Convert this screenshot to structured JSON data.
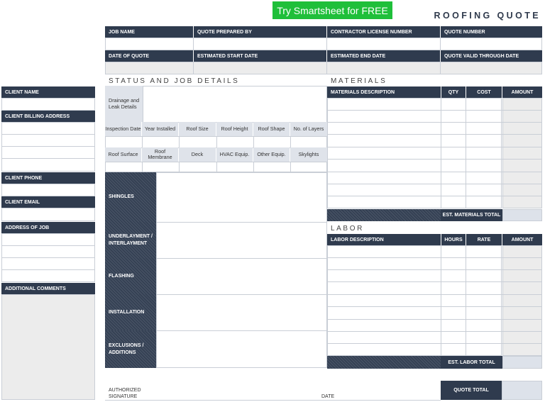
{
  "cta": "Try Smartsheet for FREE",
  "title": "ROOFING QUOTE",
  "header_fields": {
    "row1": [
      "JOB NAME",
      "QUOTE PREPARED BY",
      "CONTRACTOR LICENSE NUMBER",
      "QUOTE NUMBER"
    ],
    "row2": [
      "DATE OF QUOTE",
      "ESTIMATED START DATE",
      "ESTIMATED END DATE",
      "QUOTE VALID THROUGH DATE"
    ]
  },
  "client": {
    "name": "CLIENT NAME",
    "billing": "CLIENT BILLING ADDRESS",
    "phone": "CLIENT PHONE",
    "email": "CLIENT EMAIL",
    "address": "ADDRESS OF JOB",
    "comments": "ADDITIONAL COMMENTS"
  },
  "status": {
    "title": "STATUS AND JOB DETAILS",
    "drainage": "Drainage and Leak Details",
    "row1": [
      "Inspection Date",
      "Year Installed",
      "Roof Size",
      "Roof Height",
      "Roof Shape",
      "No. of Layers"
    ],
    "row2": [
      "Roof Surface",
      "Roof Membrane",
      "Deck",
      "HVAC Equip.",
      "Other Equip.",
      "Skylights"
    ],
    "sections": [
      "SHINGLES",
      "UNDERLAYMENT / INTERLAYMENT",
      "FLASHING",
      "INSTALLATION",
      "EXCLUSIONS / ADDITIONS"
    ]
  },
  "materials": {
    "title": "MATERIALS",
    "desc": "MATERIALS DESCRIPTION",
    "qty": "QTY",
    "cost": "COST",
    "amount": "AMOUNT",
    "total": "EST. MATERIALS TOTAL"
  },
  "labor": {
    "title": "LABOR",
    "desc": "LABOR DESCRIPTION",
    "hours": "HOURS",
    "rate": "RATE",
    "amount": "AMOUNT",
    "total": "EST. LABOR TOTAL"
  },
  "footer": {
    "signature_1": "AUTHORIZED",
    "signature_2": "SIGNATURE",
    "date": "DATE",
    "quote_total": "QUOTE TOTAL"
  }
}
